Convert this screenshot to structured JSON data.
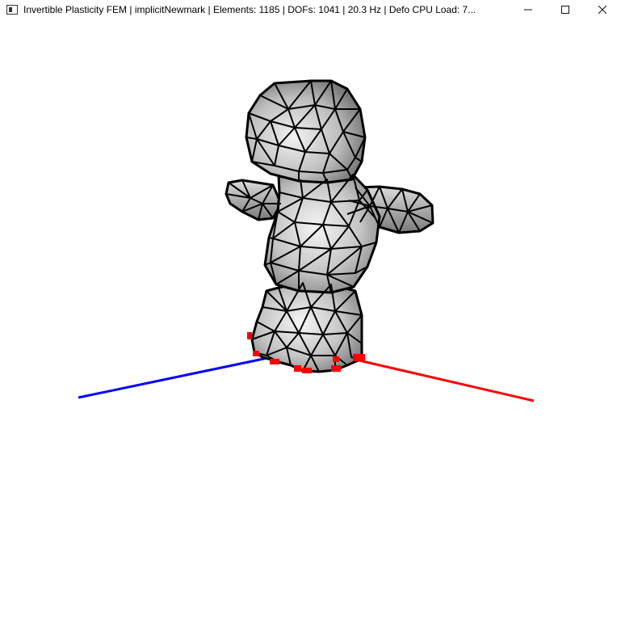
{
  "window": {
    "title": "Invertible Plasticity FEM | implicitNewmark | Elements: 1185 | DOFs: 1041 | 20.3 Hz | Defo CPU Load: 7...",
    "controls": {
      "minimize_icon": "minimize-icon",
      "maximize_icon": "maximize-icon",
      "close_icon": "close-icon"
    }
  },
  "scene": {
    "mesh_fill": "#b8b8b8",
    "mesh_edge": "#000000",
    "axis_x_color": "#ff0000",
    "axis_z_color": "#0000ff",
    "fixed_vertex_color": "#ff0000",
    "background": "#ffffff"
  }
}
